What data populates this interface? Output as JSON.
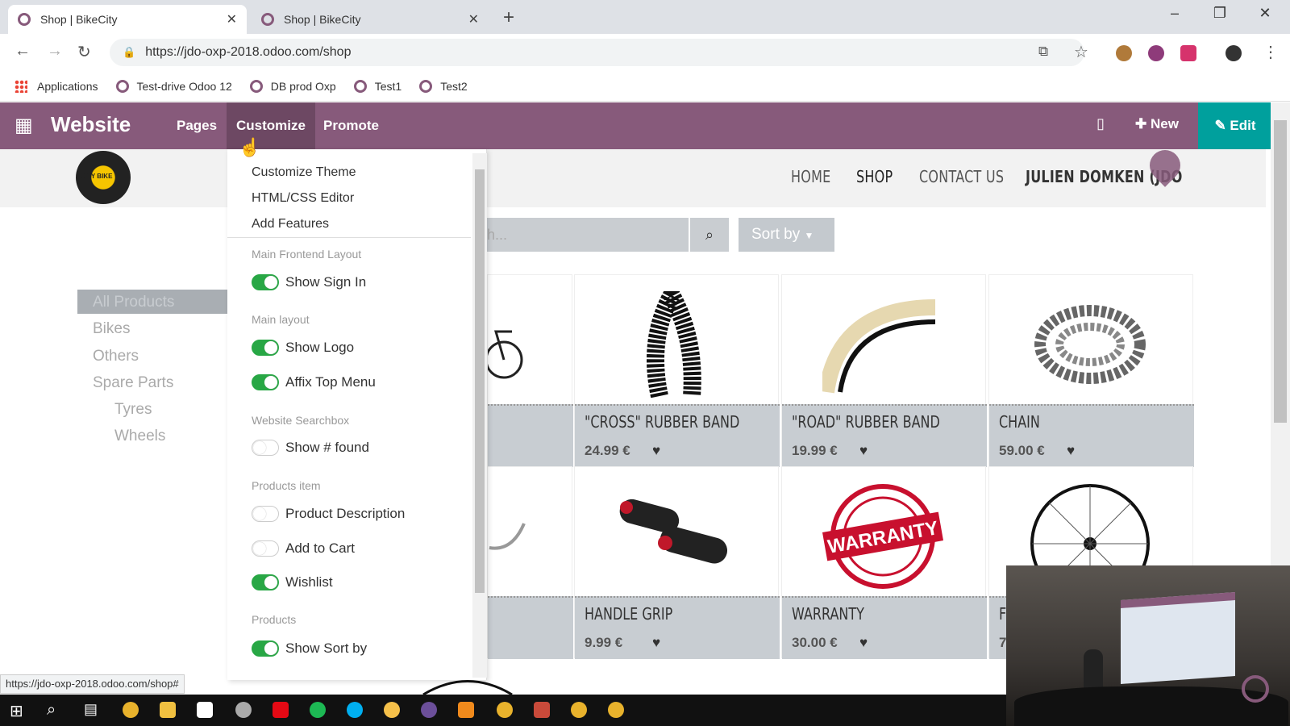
{
  "browser": {
    "tabs": [
      {
        "title": "Shop | BikeCity",
        "active": true
      },
      {
        "title": "Shop | BikeCity",
        "active": false
      }
    ],
    "new_tab": "+",
    "url": "https://jdo-oxp-2018.odoo.com/shop",
    "bookmarks": [
      "Applications",
      "Test-drive Odoo 12",
      "DB prod Oxp",
      "Test1",
      "Test2"
    ],
    "status_url": "https://jdo-oxp-2018.odoo.com/shop#"
  },
  "odoo_bar": {
    "app_name": "Website",
    "menu": [
      "Pages",
      "Customize",
      "Promote"
    ],
    "new_label": "New",
    "edit_label": "Edit"
  },
  "site": {
    "logo_text": "CITY BIKE",
    "nav": [
      "HOME",
      "SHOP",
      "CONTACT US",
      "JULIEN DOMKEN (JDO"
    ],
    "search_placeholder": "h...",
    "sort_label": "Sort by"
  },
  "categories": [
    {
      "label": "All Products",
      "active": true
    },
    {
      "label": "Bikes"
    },
    {
      "label": "Others"
    },
    {
      "label": "Spare Parts"
    },
    {
      "label": "Tyres"
    },
    {
      "label": "Wheels"
    }
  ],
  "customize_menu": {
    "links": [
      "Customize Theme",
      "HTML/CSS Editor",
      "Add Features"
    ],
    "sections": [
      {
        "header": "Main Frontend Layout",
        "options": [
          {
            "label": "Show Sign In",
            "on": true
          }
        ]
      },
      {
        "header": "Main layout",
        "options": [
          {
            "label": "Show Logo",
            "on": true
          },
          {
            "label": "Affix Top Menu",
            "on": true
          }
        ]
      },
      {
        "header": "Website Searchbox",
        "options": [
          {
            "label": "Show # found",
            "on": false
          }
        ]
      },
      {
        "header": "Products item",
        "options": [
          {
            "label": "Product Description",
            "on": false
          },
          {
            "label": "Add to Cart",
            "on": false
          },
          {
            "label": "Wishlist",
            "on": true
          }
        ]
      },
      {
        "header": "Products",
        "options": [
          {
            "label": "Show Sort by",
            "on": true
          }
        ]
      }
    ]
  },
  "products": [
    {
      "name": "\"CROSS\" RUBBER BAND",
      "price": "24.99 €"
    },
    {
      "name": "\"ROAD\" RUBBER BAND",
      "price": "19.99 €"
    },
    {
      "name": "CHAIN",
      "price": "59.00 €"
    },
    {
      "name": "HANDLE GRIP",
      "price": "9.99 €"
    },
    {
      "name": "WARRANTY",
      "price": "30.00 €"
    },
    {
      "name": "F",
      "price": "7"
    }
  ],
  "warranty_badge": "WARRANTY",
  "colors": {
    "odoo_purple": "#875a7b",
    "edit_teal": "#00a09d",
    "toggle_on": "#28a745"
  }
}
